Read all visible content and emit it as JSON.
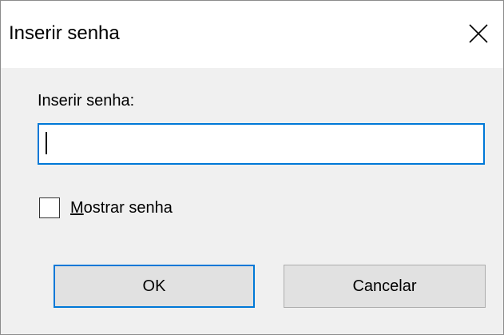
{
  "window": {
    "title": "Inserir senha"
  },
  "form": {
    "field_label": "Inserir senha:",
    "password_value": "",
    "show_password_prefix": "M",
    "show_password_rest": "ostrar senha",
    "show_password_checked": false
  },
  "buttons": {
    "ok_label": "OK",
    "cancel_label": "Cancelar"
  },
  "icons": {
    "close": "close-icon"
  },
  "colors": {
    "accent": "#0078d7",
    "button_face": "#e1e1e1",
    "dialog_background": "#f0f0f0",
    "titlebar_background": "#ffffff"
  }
}
